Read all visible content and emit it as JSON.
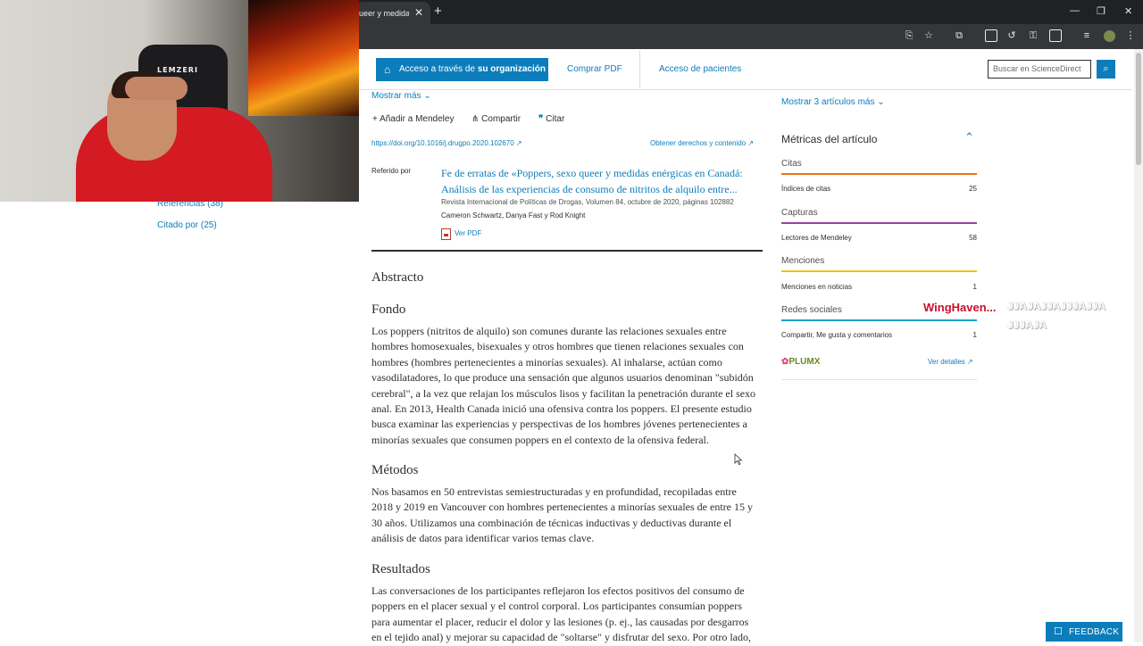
{
  "browser": {
    "tab_title": "ueer y medidas",
    "tab_close": "✕",
    "new_tab": "+",
    "window_controls": [
      "—",
      "❐",
      "✕"
    ]
  },
  "header": {
    "access_prefix": "Acceso a través de",
    "access_bold": "su organización",
    "buy_pdf": "Comprar PDF",
    "patient_access": "Acceso de pacientes",
    "search_placeholder": "Buscar en ScienceDirect"
  },
  "sidebar": {
    "references": "Referencias (38)",
    "cited_by": "Citado por (25)"
  },
  "article": {
    "show_more": "Mostrar más",
    "add_mendeley": "Añadir a Mendeley",
    "share": "Compartir",
    "cite": "Citar",
    "doi": "https://doi.org/10.1016/j.drugpo.2020.102670",
    "rights": "Obtener derechos y contenido",
    "referred_by_label": "Referido por",
    "ref_title_line1": "Fe de erratas de «Poppers, sexo queer y medidas enérgicas en Canadá:",
    "ref_title_line2": "Análisis de las experiencias de consumo de nitritos de alquilo entre...",
    "ref_journal": "Revista Internacional de Políticas de Drogas, Volumen 84, octubre de 2020, páginas 102882",
    "ref_authors": "Cameron Schwartz, Danya Fast y Rod Knight",
    "view_pdf": "Ver PDF",
    "abstract_heading": "Abstracto",
    "background_heading": "Fondo",
    "background_lines": [
      "Los poppers (nitritos de alquilo) son comunes durante las relaciones sexuales entre",
      "hombres homosexuales, bisexuales y otros hombres que tienen relaciones sexuales con",
      "hombres (hombres pertenecientes a minorías sexuales). Al inhalarse, actúan como",
      "vasodilatadores, lo que produce una sensación que algunos usuarios denominan \"subidón",
      "cerebral\", a la vez que relajan los músculos lisos y facilitan la penetración durante el sexo",
      "anal. En 2013, Health Canada inició una ofensiva contra los poppers. El presente estudio",
      "busca examinar las experiencias y perspectivas de los hombres jóvenes pertenecientes a",
      "minorías sexuales que consumen poppers en el contexto de la ofensiva federal."
    ],
    "methods_heading": "Métodos",
    "methods_lines": [
      "Nos basamos en 50 entrevistas semiestructuradas y en profundidad, recopiladas entre",
      "2018 y 2019 en Vancouver con hombres pertenecientes a minorías sexuales de entre 15 y",
      "30 años. Utilizamos una combinación de técnicas inductivas y deductivas durante el",
      "análisis de datos para identificar varios temas clave."
    ],
    "results_heading": "Resultados",
    "results_lines": [
      "Las conversaciones de los participantes reflejaron los efectos positivos del consumo de",
      "poppers en el placer sexual y el control corporal. Los participantes consumían poppers",
      "para aumentar el placer, reducir el dolor y las lesiones (p. ej., las causadas por desgarros",
      "en el tejido anal) y mejorar su capacidad de \"soltarse\" y disfrutar del sexo. Por otro lado,"
    ]
  },
  "metrics": {
    "show_more_articles": "Mostrar 3 artículos más",
    "title": "Métricas del artículo",
    "categories": [
      {
        "name": "Citas",
        "color": "#e9711c",
        "row": "Índices de citas",
        "value": "25"
      },
      {
        "name": "Capturas",
        "color": "#a03ca8",
        "row": "Lectores de Mendeley",
        "value": "58"
      },
      {
        "name": "Menciones",
        "color": "#f0c419",
        "row": "Menciones en noticias",
        "value": "1"
      },
      {
        "name": "Redes sociales",
        "color": "#1ba0c9",
        "row": "Compartir, Me gusta y comentarios",
        "value": "1"
      }
    ],
    "plumx": "PLUMX",
    "see_details": "Ver detalles"
  },
  "overlay": {
    "brand": "WingHaven...",
    "laugh_line1": "JJAJAJJAJJJAJJA",
    "laugh_line2": "JJJAJA"
  },
  "webcam": {
    "chair_logo": "LEMZERI"
  },
  "feedback": "FEEDBACK"
}
